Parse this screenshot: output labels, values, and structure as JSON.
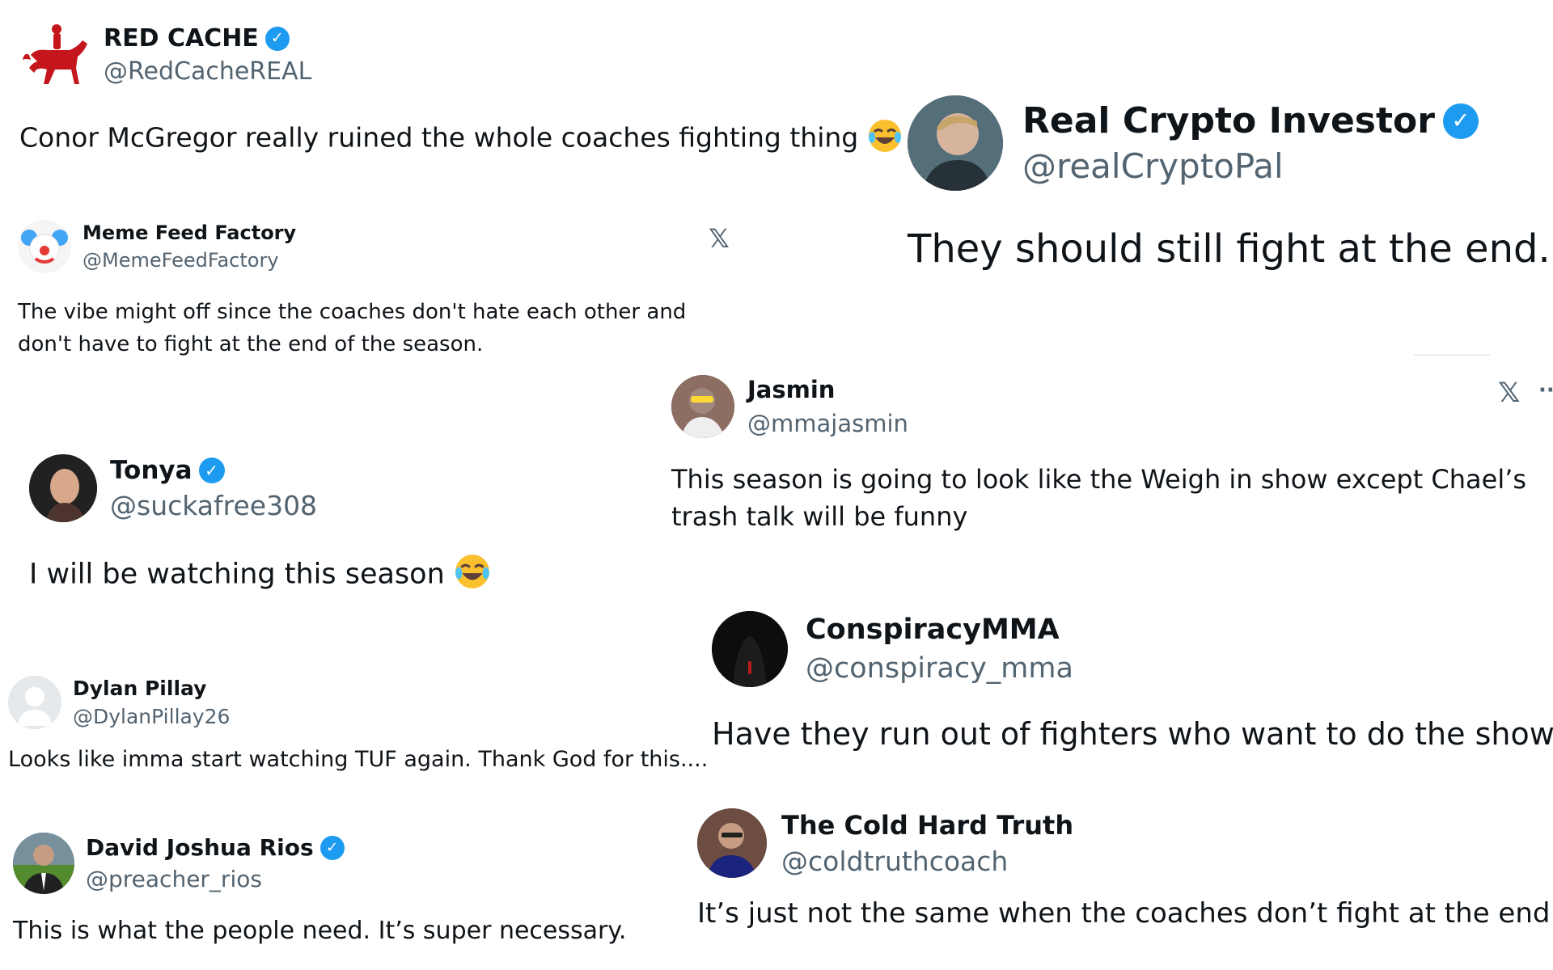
{
  "tweets": [
    {
      "id": "red_cache",
      "name": "RED CACHE",
      "handle": "@RedCacheREAL",
      "verified": true,
      "avatar_icon": "horse-rider-logo-icon",
      "text": "Conor McGregor really ruined the whole coaches fighting thing",
      "emoji": "laughing-tears-emoji"
    },
    {
      "id": "real_crypto",
      "name": "Real Crypto Investor",
      "handle": "@realCryptoPal",
      "verified": true,
      "avatar_icon": "profile-photo-man",
      "text": "They should still fight at the end."
    },
    {
      "id": "meme_feed",
      "name": "Meme Feed Factory",
      "handle": "@MemeFeedFactory",
      "verified": false,
      "avatar_icon": "clown-face-avatar",
      "text": "The vibe might off since the coaches don't hate each other and don't have to fight at the end of the season.",
      "platform_icon": "x-logo-icon"
    },
    {
      "id": "jasmin",
      "name": "Jasmin",
      "handle": "@mmajasmin",
      "verified": false,
      "avatar_icon": "profile-photo-woman",
      "text": "This season is going to look like the Weigh in show except Chael’s trash talk will be funny",
      "platform_icon": "x-logo-icon",
      "more_label": "···"
    },
    {
      "id": "tonya",
      "name": "Tonya",
      "handle": "@suckafree308",
      "verified": true,
      "avatar_icon": "profile-photo-woman",
      "text": "I will be watching this season",
      "emoji": "laughing-tears-emoji"
    },
    {
      "id": "conspiracy",
      "name": "ConspiracyMMA",
      "handle": "@conspiracy_mma",
      "verified": false,
      "avatar_icon": "hooded-figure-avatar",
      "text": "Have they run out of fighters who want to do the show?"
    },
    {
      "id": "dylan",
      "name": "Dylan Pillay",
      "handle": "@DylanPillay26",
      "verified": false,
      "avatar_icon": "default-user-avatar",
      "text": "Looks like imma start watching TUF again. Thank God for this...."
    },
    {
      "id": "cold_truth",
      "name": "The Cold Hard Truth",
      "handle": "@coldtruthcoach",
      "verified": false,
      "avatar_icon": "profile-photo-man",
      "text": "It’s just not the same when the coaches don’t fight at the end."
    },
    {
      "id": "david",
      "name": "David Joshua Rios",
      "handle": "@preacher_rios",
      "verified": true,
      "avatar_icon": "profile-photo-man",
      "text": "This is what the people need. It’s super necessary."
    }
  ],
  "colors": {
    "verified": "#1d9bf0",
    "handle": "#536471",
    "text": "#0f1419",
    "brand_red": "#c4161c"
  }
}
